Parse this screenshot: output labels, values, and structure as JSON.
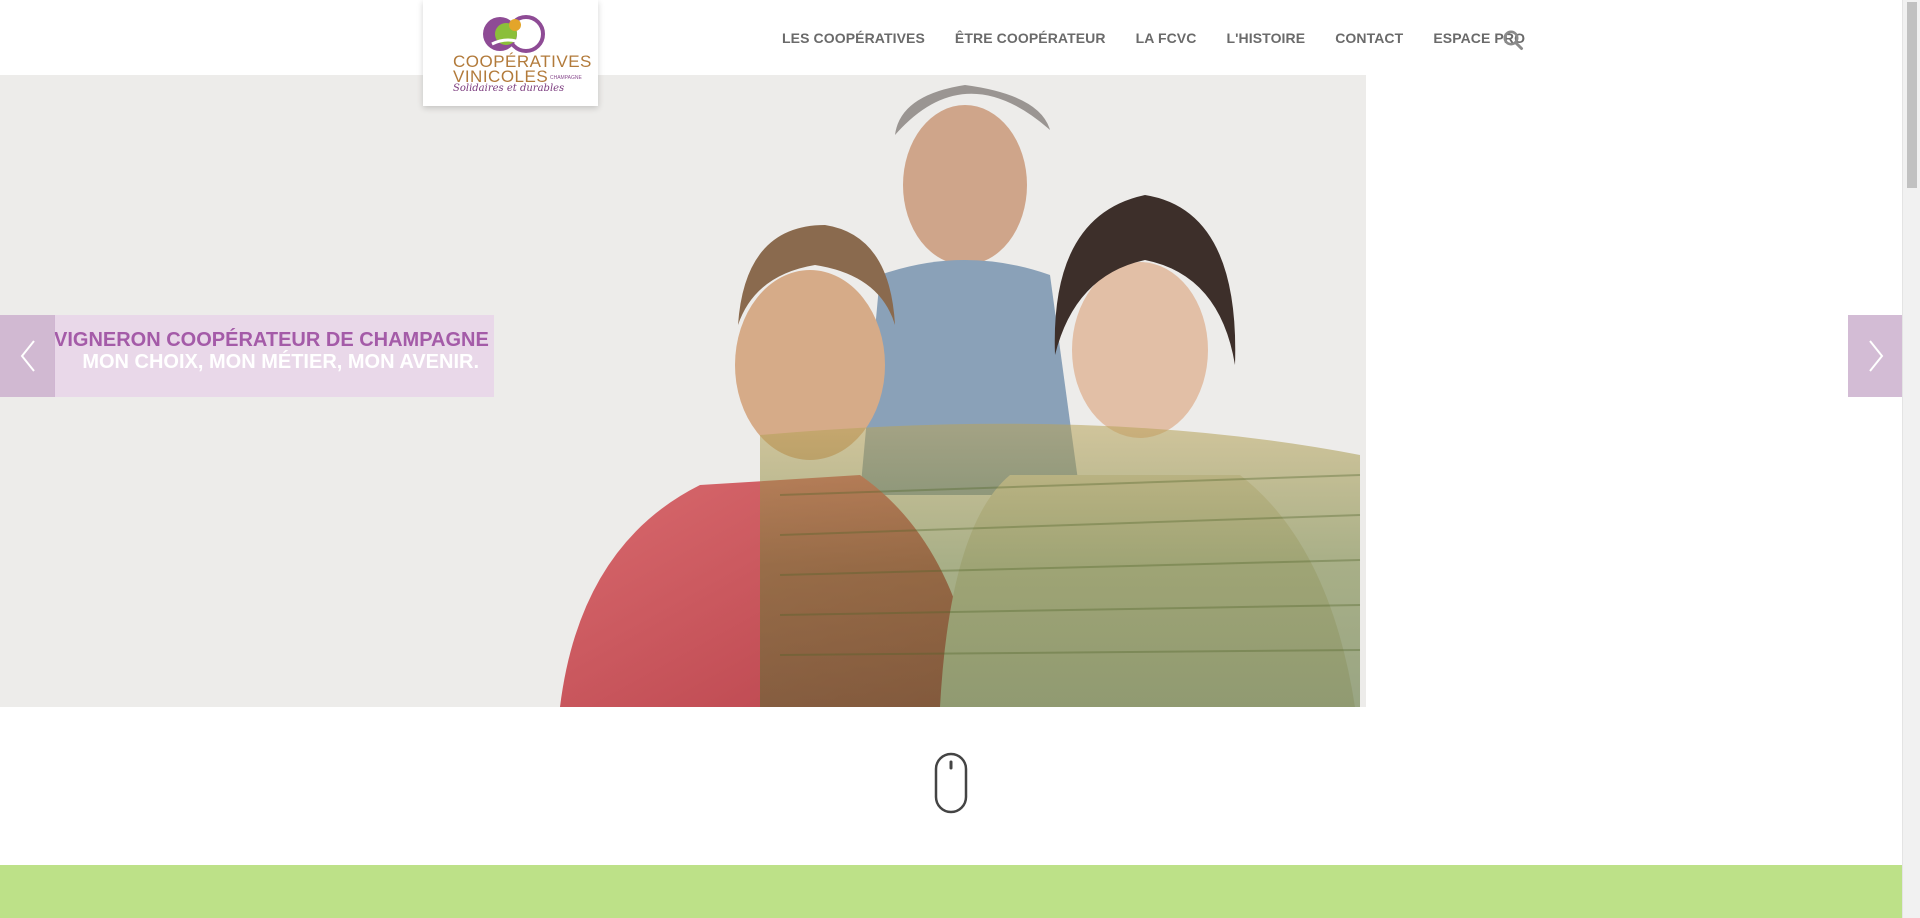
{
  "logo": {
    "line1": "COOPÉRATIVES",
    "line2": "VINICOLES",
    "small": "CHAMPAGNE",
    "tagline": "Solidaires et durables"
  },
  "nav": {
    "items": [
      "LES COOPÉRATIVES",
      "ÊTRE COOPÉRATEUR",
      "LA FCVC",
      "L'HISTOIRE",
      "CONTACT",
      "ESPACE PRO"
    ],
    "search_icon": "search-icon"
  },
  "hero": {
    "caption_line1": "VIGNERON COOPÉRATEUR DE CHAMPAGNE",
    "caption_line2": "MON CHOIX, MON MÉTIER, MON AVENIR.",
    "slides_count": 3,
    "active_slide": 1,
    "prev_icon": "chevron-left-icon",
    "next_icon": "chevron-right-icon"
  },
  "scroll_icon": "mouse-scroll-icon",
  "colors": {
    "brand_purple": "#a45ba8",
    "brand_gold": "#b27a3a",
    "nav_text": "#6a6a6a",
    "green_band": "#bde188"
  }
}
